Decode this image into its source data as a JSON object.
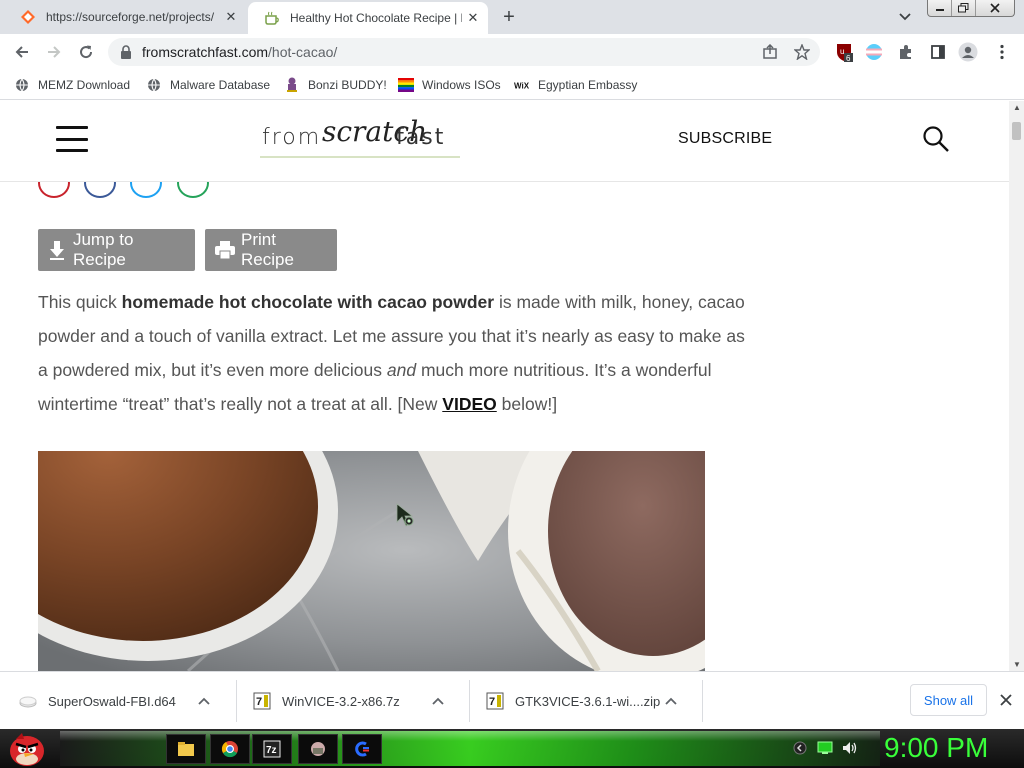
{
  "browser": {
    "tabs": [
      {
        "title": "https://sourceforge.net/projects/",
        "active": false
      },
      {
        "title": "Healthy Hot Chocolate Recipe | F",
        "active": true
      }
    ],
    "address": {
      "domain": "fromscratchfast.com",
      "path": "/hot-cacao/"
    },
    "extension_badge": "6",
    "bookmarks": [
      {
        "label": "MEMZ Download"
      },
      {
        "label": "Malware Database"
      },
      {
        "label": "Bonzi BUDDY!"
      },
      {
        "label": "Windows ISOs"
      },
      {
        "label": "Egyptian Embassy"
      }
    ]
  },
  "site": {
    "logo": {
      "part1": "from",
      "script": "scratch",
      "part2": "fast"
    },
    "subscribe_label": "SUBSCRIBE",
    "buttons": {
      "jump": "Jump to Recipe",
      "print": "Print Recipe"
    },
    "paragraph": {
      "t1": "This quick ",
      "bold": "homemade hot chocolate with cacao powder",
      "t2": " is made with milk, honey, cacao powder and a touch of vanilla extract. Let me assure you that it’s nearly as easy to make as a powdered mix, but it’s even more delicious ",
      "italic": "and",
      "t3": " much more nutritious. It’s a wonderful wintertime “treat” that’s really not a treat at all. [New ",
      "link": "VIDEO",
      "t4": " below!]"
    }
  },
  "downloads": {
    "items": [
      {
        "name": "SuperOswald-FBI.d64"
      },
      {
        "name": "WinVICE-3.2-x86.7z"
      },
      {
        "name": "GTK3VICE-3.6.1-wi....zip"
      }
    ],
    "show_all": "Show all"
  },
  "taskbar": {
    "clock": "9:00 PM"
  },
  "colors": {
    "accent_blue": "#1a73e8",
    "button_gray": "#8a8a8a",
    "clock_green": "#39ff3a"
  }
}
